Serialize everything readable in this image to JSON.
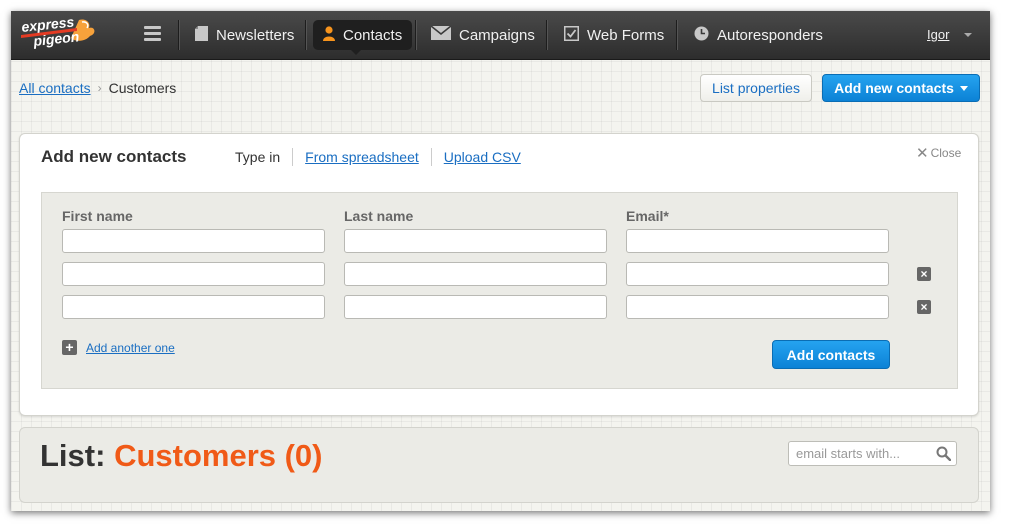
{
  "brand": {
    "logo_text_top": "express",
    "logo_text_bottom": "pigeon"
  },
  "nav": {
    "items": [
      {
        "label": "Newsletters",
        "icon": "newsletter-icon"
      },
      {
        "label": "Contacts",
        "icon": "person-icon",
        "active": true
      },
      {
        "label": "Campaigns",
        "icon": "envelope-icon"
      },
      {
        "label": "Web Forms",
        "icon": "checkbox-icon"
      },
      {
        "label": "Autoresponders",
        "icon": "clock-icon"
      }
    ],
    "menu_icon": "hamburger-icon",
    "user": "Igor"
  },
  "breadcrumb": {
    "root": "All contacts",
    "current": "Customers"
  },
  "actions": {
    "list_properties": "List properties",
    "add_new_contacts": "Add new contacts"
  },
  "add_panel": {
    "title": "Add new contacts",
    "tabs": [
      {
        "label": "Type in",
        "active": true
      },
      {
        "label": "From spreadsheet",
        "active": false
      },
      {
        "label": "Upload CSV",
        "active": false
      }
    ],
    "close_label": "Close",
    "columns": [
      "First name",
      "Last name",
      "Email*"
    ],
    "rows": [
      {
        "first": "",
        "last": "",
        "email": "",
        "removable": false
      },
      {
        "first": "",
        "last": "",
        "email": "",
        "removable": true
      },
      {
        "first": "",
        "last": "",
        "email": "",
        "removable": true
      }
    ],
    "add_another": "Add another one",
    "submit": "Add contacts"
  },
  "list": {
    "prefix": "List:",
    "name": "Customers (0)",
    "search_placeholder": "email starts with..."
  },
  "colors": {
    "accent": "#0c82d6",
    "brand_orange": "#f05a17",
    "topbar": "#3a3a3a"
  }
}
